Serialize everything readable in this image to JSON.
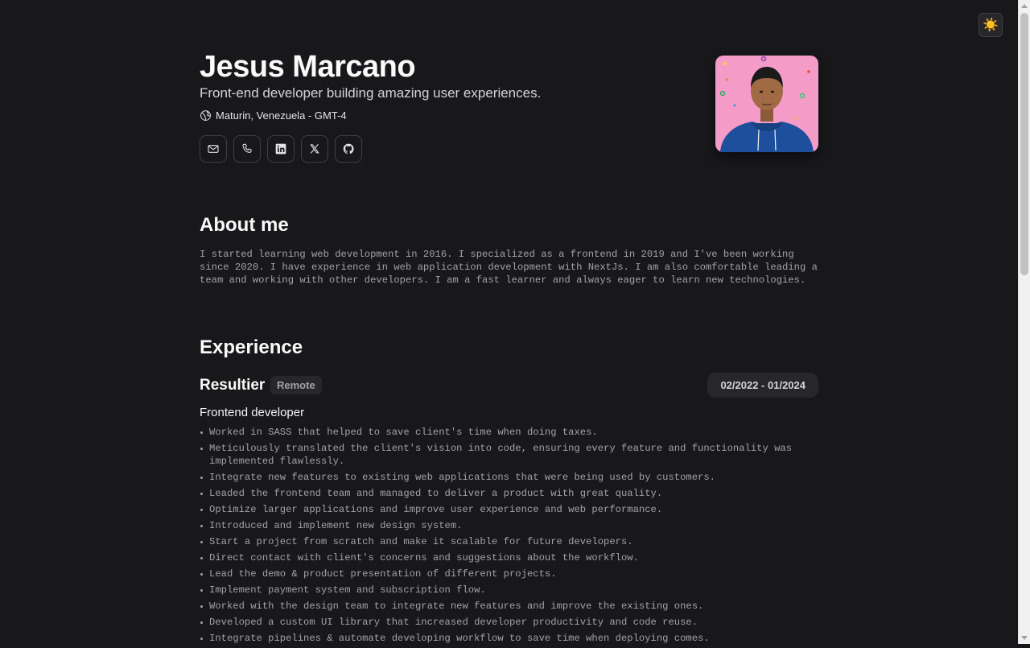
{
  "header": {
    "name": "Jesus Marcano",
    "tagline": "Front-end developer building amazing user experiences.",
    "location": "Maturin, Venezuela - GMT-4",
    "theme_toggle_icon": "☀️"
  },
  "social": [
    {
      "name": "email-icon"
    },
    {
      "name": "phone-icon"
    },
    {
      "name": "linkedin-icon"
    },
    {
      "name": "x-icon"
    },
    {
      "name": "github-icon"
    }
  ],
  "about": {
    "title": "About me",
    "text": "I started learning web development in 2016. I specialized as a frontend in 2019 and I've been working since 2020. I have experience in web application development with NextJs. I am also comfortable leading a team and working with other developers. I am a fast learner and always eager to learn new technologies."
  },
  "experience": {
    "title": "Experience",
    "jobs": [
      {
        "company": "Resultier",
        "badge": "Remote",
        "dates": "02/2022 - 01/2024",
        "role": "Frontend developer",
        "duties": [
          "Worked in SASS that helped to save client's time when doing taxes.",
          "Meticulously translated the client's vision into code, ensuring every feature and functionality was implemented flawlessly.",
          "Integrate new features to existing web applications that were being used by customers.",
          "Leaded the frontend team and managed to deliver a product with great quality.",
          "Optimize larger applications and improve user experience and web performance.",
          "Introduced and implement new design system.",
          "Start a project from scratch and make it scalable for future developers.",
          "Direct contact with client's concerns and suggestions about the workflow.",
          "Lead the demo & product presentation of different projects.",
          "Implement payment system and subscription flow.",
          "Worked with the design team to integrate new features and improve the existing ones.",
          "Developed a custom UI library that increased developer productivity and code reuse.",
          "Integrate pipelines & automate developing workflow to save time when deploying comes."
        ]
      }
    ]
  }
}
